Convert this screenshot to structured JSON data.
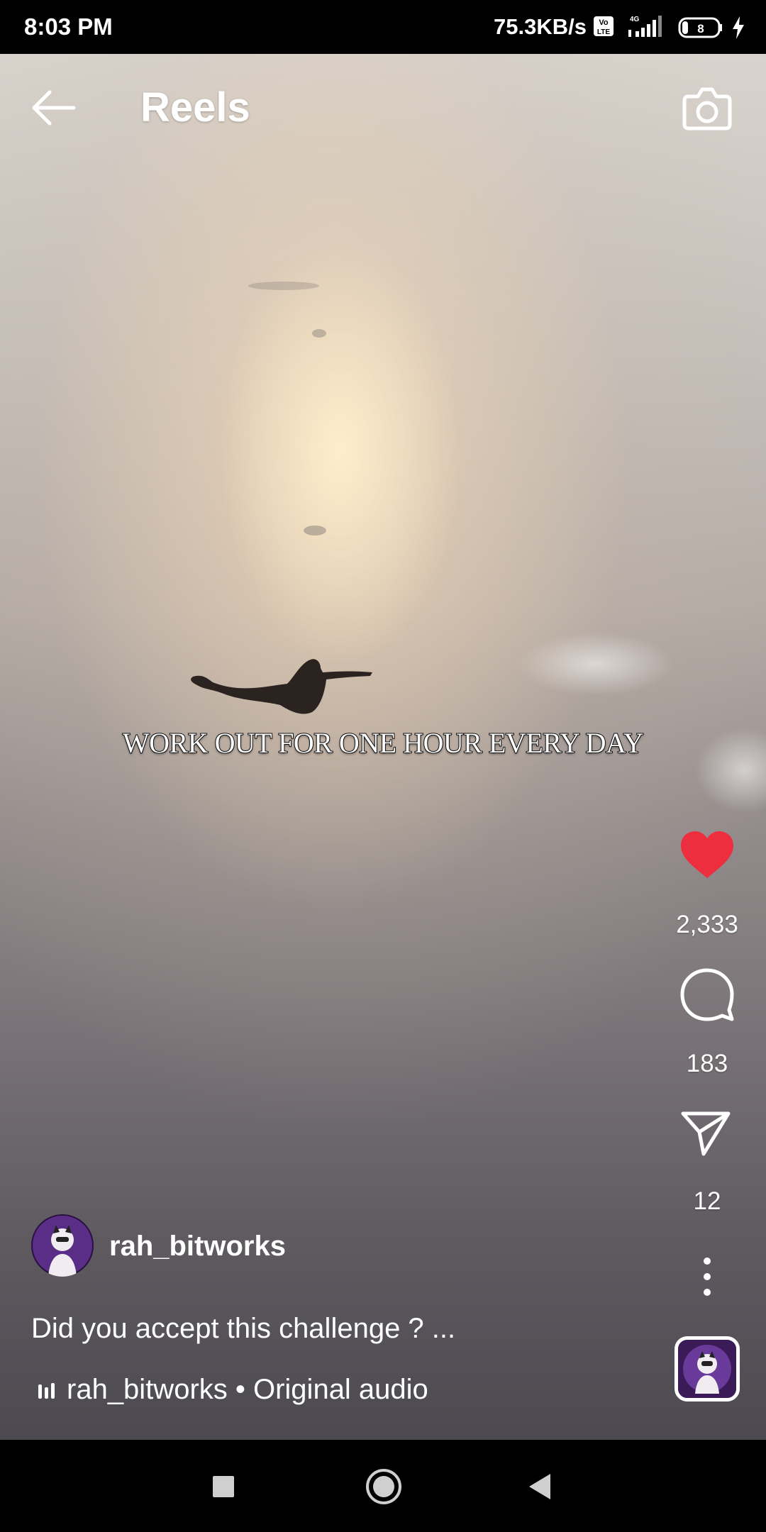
{
  "status_bar": {
    "time": "8:03 PM",
    "network_speed": "75.3KB/s",
    "network_type": "4G",
    "battery_level": "8"
  },
  "header": {
    "title": "Reels"
  },
  "video": {
    "overlay_text": "WORK OUT FOR ONE HOUR EVERY DAY"
  },
  "actions": {
    "likes": "2,333",
    "comments": "183",
    "shares": "12",
    "like_color": "#ed2e3f"
  },
  "post": {
    "username": "rah_bitworks",
    "caption": "Did you accept this challenge ? ...",
    "audio": "rah_bitworks • Original audio"
  },
  "icons": {
    "back": "arrow-left-icon",
    "camera": "camera-icon",
    "like": "heart-icon",
    "comment": "speech-bubble-icon",
    "share": "paper-plane-icon",
    "more": "more-vertical-icon",
    "audio": "audio-bars-icon"
  }
}
